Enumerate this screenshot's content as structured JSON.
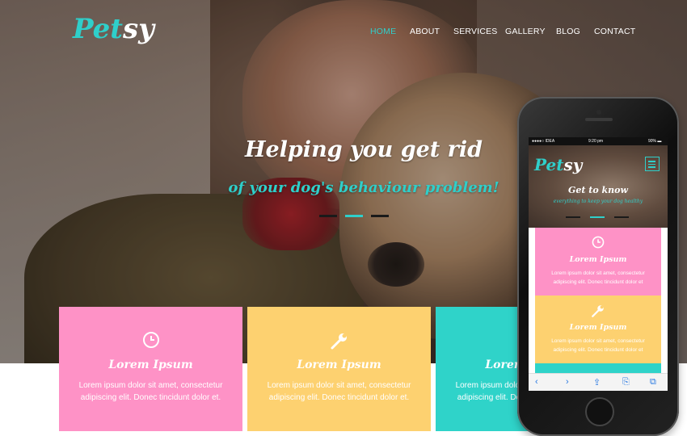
{
  "brand": {
    "logo_part1": "Pet",
    "logo_part2": "sy",
    "accent": "#2fcfca"
  },
  "nav": {
    "items": [
      "HOME",
      "ABOUT",
      "SERVICES",
      "GALLERY",
      "BLOG",
      "CONTACT"
    ],
    "active_index": 0
  },
  "hero": {
    "headline": "Helping you get rid",
    "subheadline": "of your dog's behaviour problem!",
    "slides": 3,
    "active_slide": 1
  },
  "cards": [
    {
      "title": "Lorem Ipsum",
      "text": "Lorem ipsum dolor sit amet, consectetur adipiscing elit. Donec tincidunt dolor et.",
      "color": "#fe92c6",
      "icon": "clock-icon"
    },
    {
      "title": "Lorem Ipsum",
      "text": "Lorem ipsum dolor sit amet, consectetur adipiscing elit. Donec tincidunt dolor et.",
      "color": "#fdd170",
      "icon": "wrench-icon"
    },
    {
      "title": "Lorem Ipsum",
      "text": "Lorem ipsum dolor sit amet, consectetur adipiscing elit. Donec tincidunt dolor et.",
      "color": "#2fd3c9",
      "icon": "star-icon"
    }
  ],
  "phone": {
    "status_carrier": "●●●●○ IDEA",
    "status_time": "9:20 pm",
    "status_battery": "90% ▬",
    "headline": "Get to know",
    "subheadline": "everything to keep your dog healthy",
    "cards": [
      {
        "title": "Lorem Ipsum",
        "text": "Lorem ipsum dolor sit amet, consectetur adipiscing elit. Donec tincidunt dolor et",
        "color": "#fe92c6",
        "icon": "clock-icon"
      },
      {
        "title": "Lorem Ipsum",
        "text": "Lorem ipsum dolor sit amet, consectetur adipiscing elit. Donec tincidunt dolor et",
        "color": "#fdd170",
        "icon": "wrench-icon"
      }
    ],
    "browser_bar": [
      "‹",
      "›",
      "⇪",
      "⎘",
      "⧉"
    ]
  }
}
